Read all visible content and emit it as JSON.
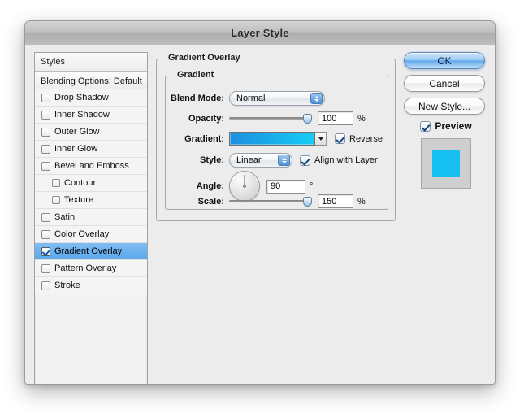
{
  "window": {
    "title": "Layer Style"
  },
  "sidebar": {
    "header": "Styles",
    "blending_options": "Blending Options: Default",
    "effects": [
      {
        "label": "Drop Shadow",
        "checked": false,
        "indent": false,
        "selected": false
      },
      {
        "label": "Inner Shadow",
        "checked": false,
        "indent": false,
        "selected": false
      },
      {
        "label": "Outer Glow",
        "checked": false,
        "indent": false,
        "selected": false
      },
      {
        "label": "Inner Glow",
        "checked": false,
        "indent": false,
        "selected": false
      },
      {
        "label": "Bevel and Emboss",
        "checked": false,
        "indent": false,
        "selected": false
      },
      {
        "label": "Contour",
        "checked": false,
        "indent": true,
        "selected": false
      },
      {
        "label": "Texture",
        "checked": false,
        "indent": true,
        "selected": false
      },
      {
        "label": "Satin",
        "checked": false,
        "indent": false,
        "selected": false
      },
      {
        "label": "Color Overlay",
        "checked": false,
        "indent": false,
        "selected": false
      },
      {
        "label": "Gradient Overlay",
        "checked": true,
        "indent": false,
        "selected": true
      },
      {
        "label": "Pattern Overlay",
        "checked": false,
        "indent": false,
        "selected": false
      },
      {
        "label": "Stroke",
        "checked": false,
        "indent": false,
        "selected": false
      }
    ]
  },
  "main": {
    "group_title": "Gradient Overlay",
    "subgroup_title": "Gradient",
    "blend_mode": {
      "label": "Blend Mode:",
      "value": "Normal"
    },
    "opacity": {
      "label": "Opacity:",
      "value": "100",
      "unit": "%",
      "percent": 100
    },
    "gradient": {
      "label": "Gradient:",
      "color_start": "#1a8fe0",
      "color_end": "#18ccf5",
      "reverse_label": "Reverse",
      "reverse_checked": true
    },
    "style": {
      "label": "Style:",
      "value": "Linear",
      "align_label": "Align with Layer",
      "align_checked": true
    },
    "angle": {
      "label": "Angle:",
      "value": "90",
      "unit": "°",
      "degrees": 90
    },
    "scale": {
      "label": "Scale:",
      "value": "150",
      "unit": "%",
      "percent": 100
    }
  },
  "right_panel": {
    "ok_label": "OK",
    "cancel_label": "Cancel",
    "new_style_label": "New Style...",
    "preview_label": "Preview",
    "preview_checked": true,
    "preview_swatch_color": "#17c0f2",
    "preview_background": "#cfcfcf"
  }
}
